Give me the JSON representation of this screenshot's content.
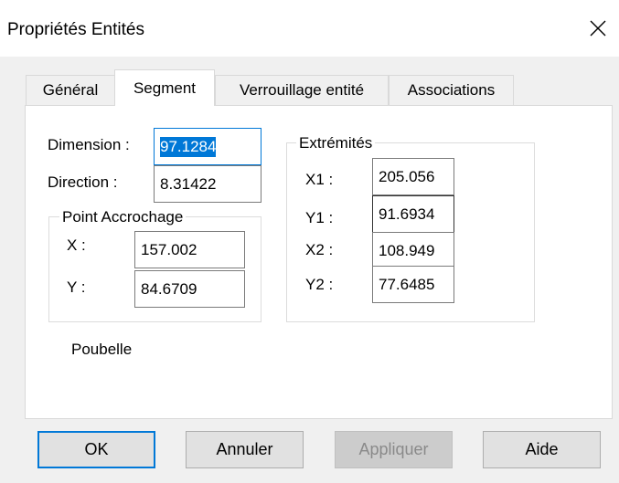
{
  "window": {
    "title": "Propriétés Entités",
    "close_icon": "close-icon"
  },
  "tabs": [
    {
      "label": "Général",
      "active": false
    },
    {
      "label": "Segment",
      "active": true
    },
    {
      "label": "Verrouillage entité",
      "active": false
    },
    {
      "label": "Associations",
      "active": false
    }
  ],
  "segment": {
    "dimension": {
      "label": "Dimension :",
      "value": "97.1284"
    },
    "direction": {
      "label": "Direction :",
      "value": "8.31422"
    },
    "point_accrochage": {
      "title": "Point Accrochage",
      "x": {
        "label": "X :",
        "value": "157.002"
      },
      "y": {
        "label": "Y :",
        "value": "84.6709"
      }
    },
    "extremites": {
      "title": "Extrémités",
      "x1": {
        "label": "X1 :",
        "value": "205.056"
      },
      "y1": {
        "label": "Y1 :",
        "value": "91.6934"
      },
      "x2": {
        "label": "X2 :",
        "value": "108.949"
      },
      "y2": {
        "label": "Y2 :",
        "value": "77.6485"
      }
    },
    "poubelle": {
      "label": "Poubelle",
      "checked": false
    }
  },
  "buttons": {
    "ok": "OK",
    "cancel": "Annuler",
    "apply": "Appliquer",
    "help": "Aide"
  },
  "colors": {
    "accent": "#0078d7",
    "dialog_bg": "#f0f0f0",
    "disabled_text": "#8a8a8a"
  }
}
